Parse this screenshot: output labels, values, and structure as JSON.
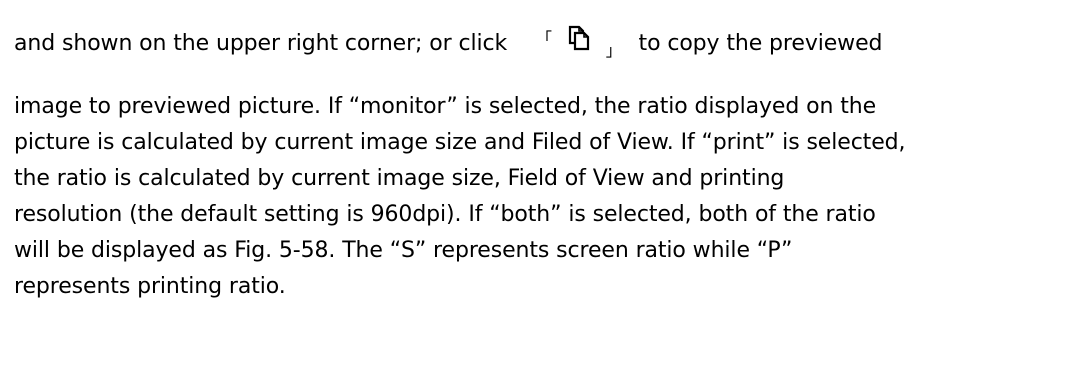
{
  "paragraph": {
    "line1_before": "and shown on the upper right corner; or click",
    "bracket_open": "「",
    "copy_icon": "copy-icon",
    "bracket_close": "」",
    "line1_after": "to copy the previewed",
    "line2": "image to previewed picture. If “monitor” is selected, the ratio displayed on the",
    "line3": "picture is calculated by current image size and Filed of View. If “print” is selected,",
    "line4": "the ratio is calculated by current image size, Field of View and printing",
    "line5": "resolution (the default setting is 960dpi). If “both” is selected, both of the ratio",
    "line6": "will be displayed as Fig. 5-58. The “S” represents screen ratio while “P”",
    "line7": "represents printing ratio."
  }
}
